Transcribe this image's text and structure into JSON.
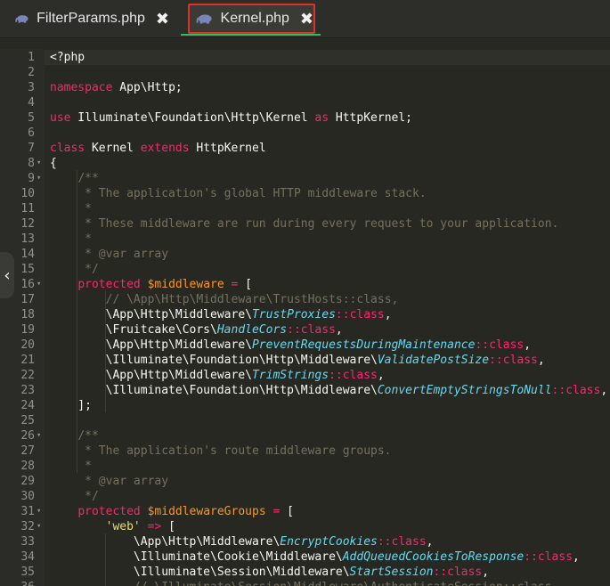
{
  "tabs": [
    {
      "label": "FilterParams.php",
      "close": "✖",
      "icon": "php-elephant-icon"
    },
    {
      "label": "Kernel.php",
      "close": "✖",
      "icon": "php-elephant-icon",
      "active": true
    }
  ],
  "colors": {
    "background": "#272822",
    "keyword": "#f92672",
    "variable": "#fd971f",
    "comment": "#75715e",
    "class": "#66d9ef",
    "string": "#e6db74",
    "active_tab_underline": "#2ebd5f",
    "highlight_border": "#e0302a"
  },
  "side_handle": "‹",
  "code_lines": [
    {
      "n": "1",
      "fold": "",
      "tokens": [
        [
          "",
          "<?php"
        ]
      ]
    },
    {
      "n": "2",
      "fold": "",
      "tokens": []
    },
    {
      "n": "3",
      "fold": "",
      "tokens": [
        [
          "kw",
          "namespace"
        ],
        [
          "",
          " App\\Http;"
        ]
      ]
    },
    {
      "n": "4",
      "fold": "",
      "tokens": []
    },
    {
      "n": "5",
      "fold": "",
      "tokens": [
        [
          "kw",
          "use"
        ],
        [
          "",
          " Illuminate\\Foundation\\Http\\Kernel "
        ],
        [
          "kw",
          "as"
        ],
        [
          "",
          " HttpKernel;"
        ]
      ]
    },
    {
      "n": "6",
      "fold": "",
      "tokens": []
    },
    {
      "n": "7",
      "fold": "",
      "tokens": [
        [
          "kw",
          "class"
        ],
        [
          "",
          " Kernel "
        ],
        [
          "kw",
          "extends"
        ],
        [
          "",
          " HttpKernel"
        ]
      ]
    },
    {
      "n": "8",
      "fold": "▾",
      "tokens": [
        [
          "",
          "{"
        ]
      ]
    },
    {
      "n": "9",
      "fold": "▾",
      "tokens": [
        [
          "",
          "    "
        ],
        [
          "cmt",
          "/**"
        ]
      ]
    },
    {
      "n": "10",
      "fold": "",
      "tokens": [
        [
          "",
          "    "
        ],
        [
          "cmt",
          " * The application's global HTTP middleware stack."
        ]
      ]
    },
    {
      "n": "11",
      "fold": "",
      "tokens": [
        [
          "",
          "    "
        ],
        [
          "cmt",
          " *"
        ]
      ]
    },
    {
      "n": "12",
      "fold": "",
      "tokens": [
        [
          "",
          "    "
        ],
        [
          "cmt",
          " * These middleware are run during every request to your application."
        ]
      ]
    },
    {
      "n": "13",
      "fold": "",
      "tokens": [
        [
          "",
          "    "
        ],
        [
          "cmt",
          " *"
        ]
      ]
    },
    {
      "n": "14",
      "fold": "",
      "tokens": [
        [
          "",
          "    "
        ],
        [
          "cmt",
          " * @var array"
        ]
      ]
    },
    {
      "n": "15",
      "fold": "",
      "tokens": [
        [
          "",
          "    "
        ],
        [
          "cmt",
          " */"
        ]
      ]
    },
    {
      "n": "16",
      "fold": "▾",
      "tokens": [
        [
          "",
          "    "
        ],
        [
          "kw",
          "protected"
        ],
        [
          "",
          " "
        ],
        [
          "var",
          "$middleware"
        ],
        [
          "",
          " "
        ],
        [
          "kw",
          "="
        ],
        [
          "",
          " ["
        ]
      ]
    },
    {
      "n": "17",
      "fold": "",
      "tokens": [
        [
          "",
          "        "
        ],
        [
          "cmt",
          "// \\App\\Http\\Middleware\\TrustHosts::class,"
        ]
      ]
    },
    {
      "n": "18",
      "fold": "",
      "tokens": [
        [
          "",
          "        \\App\\Http\\Middleware\\"
        ],
        [
          "cls",
          "TrustProxies"
        ],
        [
          "kw",
          "::"
        ],
        [
          "kw",
          "class"
        ],
        [
          "",
          ","
        ]
      ]
    },
    {
      "n": "19",
      "fold": "",
      "tokens": [
        [
          "",
          "        \\Fruitcake\\Cors\\"
        ],
        [
          "cls",
          "HandleCors"
        ],
        [
          "kw",
          "::"
        ],
        [
          "kw",
          "class"
        ],
        [
          "",
          ","
        ]
      ]
    },
    {
      "n": "20",
      "fold": "",
      "tokens": [
        [
          "",
          "        \\App\\Http\\Middleware\\"
        ],
        [
          "cls",
          "PreventRequestsDuringMaintenance"
        ],
        [
          "kw",
          "::"
        ],
        [
          "kw",
          "class"
        ],
        [
          "",
          ","
        ]
      ]
    },
    {
      "n": "21",
      "fold": "",
      "tokens": [
        [
          "",
          "        \\Illuminate\\Foundation\\Http\\Middleware\\"
        ],
        [
          "cls",
          "ValidatePostSize"
        ],
        [
          "kw",
          "::"
        ],
        [
          "kw",
          "class"
        ],
        [
          "",
          ","
        ]
      ]
    },
    {
      "n": "22",
      "fold": "",
      "tokens": [
        [
          "",
          "        \\App\\Http\\Middleware\\"
        ],
        [
          "cls",
          "TrimStrings"
        ],
        [
          "kw",
          "::"
        ],
        [
          "kw",
          "class"
        ],
        [
          "",
          ","
        ]
      ]
    },
    {
      "n": "23",
      "fold": "",
      "tokens": [
        [
          "",
          "        \\Illuminate\\Foundation\\Http\\Middleware\\"
        ],
        [
          "cls",
          "ConvertEmptyStringsToNull"
        ],
        [
          "kw",
          "::"
        ],
        [
          "kw",
          "class"
        ],
        [
          "",
          ","
        ]
      ]
    },
    {
      "n": "24",
      "fold": "",
      "tokens": [
        [
          "",
          "    ];"
        ]
      ]
    },
    {
      "n": "25",
      "fold": "",
      "tokens": []
    },
    {
      "n": "26",
      "fold": "▾",
      "tokens": [
        [
          "",
          "    "
        ],
        [
          "cmt",
          "/**"
        ]
      ]
    },
    {
      "n": "27",
      "fold": "",
      "tokens": [
        [
          "",
          "    "
        ],
        [
          "cmt",
          " * The application's route middleware groups."
        ]
      ]
    },
    {
      "n": "28",
      "fold": "",
      "tokens": [
        [
          "",
          "    "
        ],
        [
          "cmt",
          " *"
        ]
      ]
    },
    {
      "n": "29",
      "fold": "",
      "tokens": [
        [
          "",
          "    "
        ],
        [
          "cmt",
          " * @var array"
        ]
      ]
    },
    {
      "n": "30",
      "fold": "",
      "tokens": [
        [
          "",
          "    "
        ],
        [
          "cmt",
          " */"
        ]
      ]
    },
    {
      "n": "31",
      "fold": "▾",
      "tokens": [
        [
          "",
          "    "
        ],
        [
          "kw",
          "protected"
        ],
        [
          "",
          " "
        ],
        [
          "var",
          "$middlewareGroups"
        ],
        [
          "",
          " "
        ],
        [
          "kw",
          "="
        ],
        [
          "",
          " ["
        ]
      ]
    },
    {
      "n": "32",
      "fold": "▾",
      "tokens": [
        [
          "",
          "        "
        ],
        [
          "str",
          "'web'"
        ],
        [
          "",
          " "
        ],
        [
          "kw",
          "=>"
        ],
        [
          "",
          " ["
        ]
      ]
    },
    {
      "n": "33",
      "fold": "",
      "tokens": [
        [
          "",
          "            \\App\\Http\\Middleware\\"
        ],
        [
          "cls",
          "EncryptCookies"
        ],
        [
          "kw",
          "::"
        ],
        [
          "kw",
          "class"
        ],
        [
          "",
          ","
        ]
      ]
    },
    {
      "n": "34",
      "fold": "",
      "tokens": [
        [
          "",
          "            \\Illuminate\\Cookie\\Middleware\\"
        ],
        [
          "cls",
          "AddQueuedCookiesToResponse"
        ],
        [
          "kw",
          "::"
        ],
        [
          "kw",
          "class"
        ],
        [
          "",
          ","
        ]
      ]
    },
    {
      "n": "35",
      "fold": "",
      "tokens": [
        [
          "",
          "            \\Illuminate\\Session\\Middleware\\"
        ],
        [
          "cls",
          "StartSession"
        ],
        [
          "kw",
          "::"
        ],
        [
          "kw",
          "class"
        ],
        [
          "",
          ","
        ]
      ]
    },
    {
      "n": "36",
      "fold": "",
      "tokens": [
        [
          "",
          "            "
        ],
        [
          "cmt",
          "// \\Illuminate\\Session\\Middleware\\AuthenticateSession::class,"
        ]
      ]
    }
  ]
}
